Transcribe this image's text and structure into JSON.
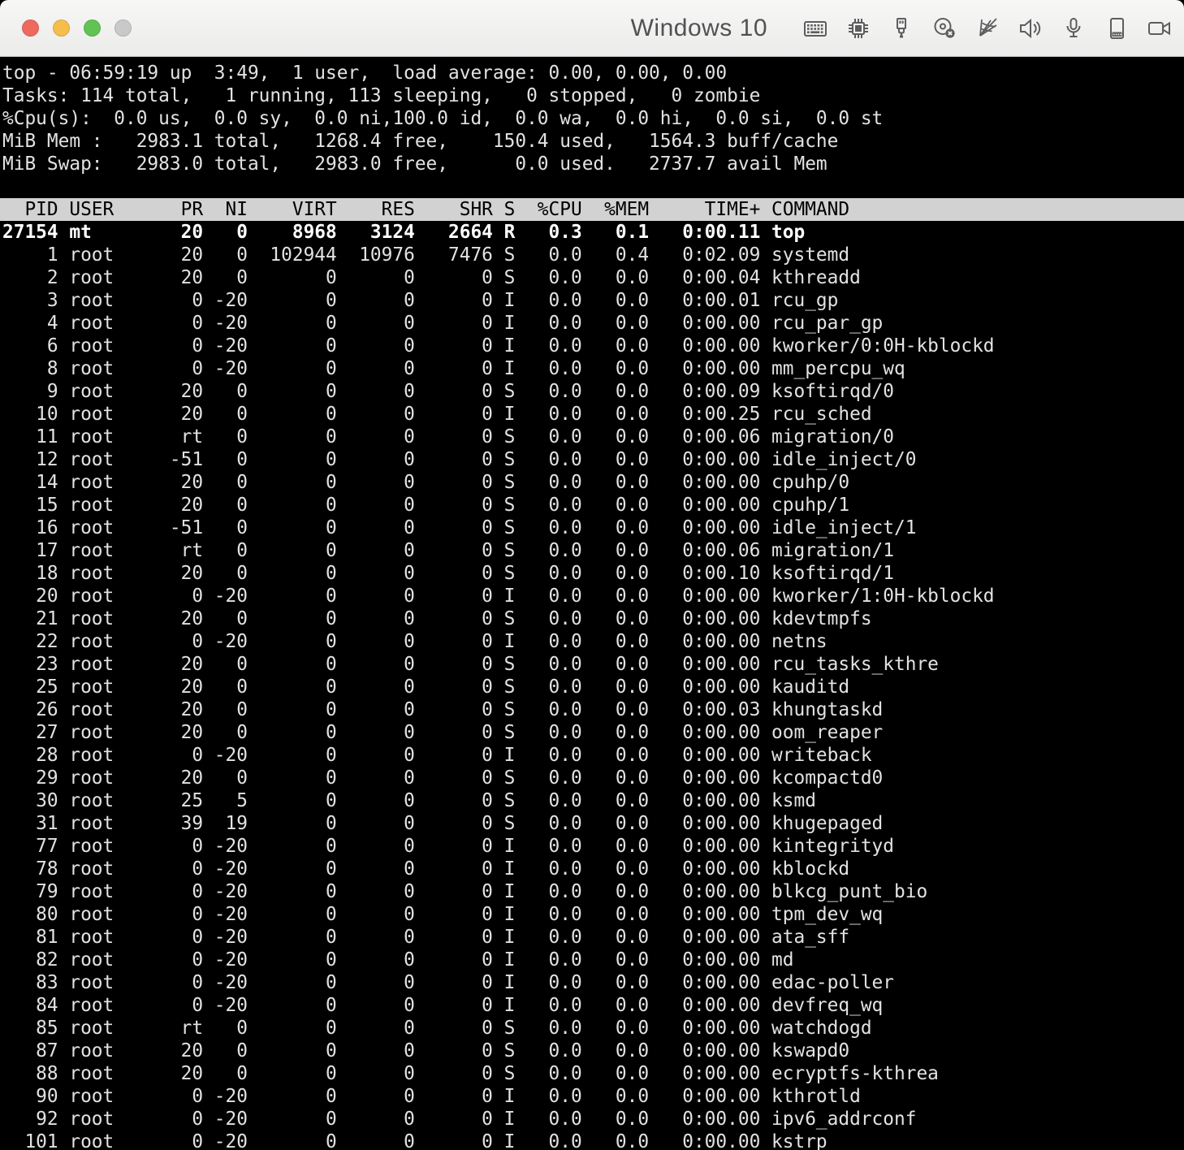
{
  "window": {
    "title": "Windows 10",
    "traffic_lights": [
      {
        "name": "close-button",
        "color": "#ee6a5f"
      },
      {
        "name": "minimize-button",
        "color": "#f5bd4c"
      },
      {
        "name": "zoom-button",
        "color": "#61c354"
      },
      {
        "name": "window-options-button",
        "color": "#c9c9c9"
      }
    ],
    "status_icons": [
      {
        "name": "keyboard-icon"
      },
      {
        "name": "cpu-icon"
      },
      {
        "name": "usb-icon"
      },
      {
        "name": "optical-disc-icon"
      },
      {
        "name": "network-icon"
      },
      {
        "name": "volume-icon"
      },
      {
        "name": "microphone-icon"
      },
      {
        "name": "external-drive-icon"
      },
      {
        "name": "video-camera-icon"
      }
    ]
  },
  "colors": {
    "terminal_bg": "#000000",
    "terminal_fg": "#e2e2e2",
    "table_header_bg": "#d2d2d2",
    "table_header_fg": "#000000",
    "running_row_fg": "#ffffff",
    "titlebar_text": "#515153",
    "icon_color": "#5d5d5f"
  },
  "terminal": {
    "summary_lines": [
      "top - 06:59:19 up  3:49,  1 user,  load average: 0.00, 0.00, 0.00",
      "Tasks: 114 total,   1 running, 113 sleeping,   0 stopped,   0 zombie",
      "%Cpu(s):  0.0 us,  0.0 sy,  0.0 ni,100.0 id,  0.0 wa,  0.0 hi,  0.0 si,  0.0 st",
      "MiB Mem :   2983.1 total,   1268.4 free,    150.4 used,   1564.3 buff/cache",
      "MiB Swap:   2983.0 total,   2983.0 free,      0.0 used.   2737.7 avail Mem"
    ],
    "table": {
      "columns": [
        {
          "label": "PID",
          "width": 5,
          "align": "right"
        },
        {
          "label": "USER",
          "width": 8,
          "align": "left"
        },
        {
          "label": "PR",
          "width": 3,
          "align": "right"
        },
        {
          "label": "NI",
          "width": 3,
          "align": "right"
        },
        {
          "label": "VIRT",
          "width": 7,
          "align": "right"
        },
        {
          "label": "RES",
          "width": 6,
          "align": "right"
        },
        {
          "label": "SHR",
          "width": 6,
          "align": "right"
        },
        {
          "label": "S",
          "width": 1,
          "align": "left"
        },
        {
          "label": "%CPU",
          "width": 5,
          "align": "right"
        },
        {
          "label": "%MEM",
          "width": 5,
          "align": "right"
        },
        {
          "label": "TIME+",
          "width": 9,
          "align": "right"
        },
        {
          "label": "COMMAND",
          "width": 7,
          "align": "left"
        }
      ],
      "running_row_index": 0,
      "processes": [
        [
          "27154",
          "mt",
          "20",
          "0",
          "8968",
          "3124",
          "2664",
          "R",
          "0.3",
          "0.1",
          "0:00.11",
          "top"
        ],
        [
          "1",
          "root",
          "20",
          "0",
          "102944",
          "10976",
          "7476",
          "S",
          "0.0",
          "0.4",
          "0:02.09",
          "systemd"
        ],
        [
          "2",
          "root",
          "20",
          "0",
          "0",
          "0",
          "0",
          "S",
          "0.0",
          "0.0",
          "0:00.04",
          "kthreadd"
        ],
        [
          "3",
          "root",
          "0",
          "-20",
          "0",
          "0",
          "0",
          "I",
          "0.0",
          "0.0",
          "0:00.01",
          "rcu_gp"
        ],
        [
          "4",
          "root",
          "0",
          "-20",
          "0",
          "0",
          "0",
          "I",
          "0.0",
          "0.0",
          "0:00.00",
          "rcu_par_gp"
        ],
        [
          "6",
          "root",
          "0",
          "-20",
          "0",
          "0",
          "0",
          "I",
          "0.0",
          "0.0",
          "0:00.00",
          "kworker/0:0H-kblockd"
        ],
        [
          "8",
          "root",
          "0",
          "-20",
          "0",
          "0",
          "0",
          "I",
          "0.0",
          "0.0",
          "0:00.00",
          "mm_percpu_wq"
        ],
        [
          "9",
          "root",
          "20",
          "0",
          "0",
          "0",
          "0",
          "S",
          "0.0",
          "0.0",
          "0:00.09",
          "ksoftirqd/0"
        ],
        [
          "10",
          "root",
          "20",
          "0",
          "0",
          "0",
          "0",
          "I",
          "0.0",
          "0.0",
          "0:00.25",
          "rcu_sched"
        ],
        [
          "11",
          "root",
          "rt",
          "0",
          "0",
          "0",
          "0",
          "S",
          "0.0",
          "0.0",
          "0:00.06",
          "migration/0"
        ],
        [
          "12",
          "root",
          "-51",
          "0",
          "0",
          "0",
          "0",
          "S",
          "0.0",
          "0.0",
          "0:00.00",
          "idle_inject/0"
        ],
        [
          "14",
          "root",
          "20",
          "0",
          "0",
          "0",
          "0",
          "S",
          "0.0",
          "0.0",
          "0:00.00",
          "cpuhp/0"
        ],
        [
          "15",
          "root",
          "20",
          "0",
          "0",
          "0",
          "0",
          "S",
          "0.0",
          "0.0",
          "0:00.00",
          "cpuhp/1"
        ],
        [
          "16",
          "root",
          "-51",
          "0",
          "0",
          "0",
          "0",
          "S",
          "0.0",
          "0.0",
          "0:00.00",
          "idle_inject/1"
        ],
        [
          "17",
          "root",
          "rt",
          "0",
          "0",
          "0",
          "0",
          "S",
          "0.0",
          "0.0",
          "0:00.06",
          "migration/1"
        ],
        [
          "18",
          "root",
          "20",
          "0",
          "0",
          "0",
          "0",
          "S",
          "0.0",
          "0.0",
          "0:00.10",
          "ksoftirqd/1"
        ],
        [
          "20",
          "root",
          "0",
          "-20",
          "0",
          "0",
          "0",
          "I",
          "0.0",
          "0.0",
          "0:00.00",
          "kworker/1:0H-kblockd"
        ],
        [
          "21",
          "root",
          "20",
          "0",
          "0",
          "0",
          "0",
          "S",
          "0.0",
          "0.0",
          "0:00.00",
          "kdevtmpfs"
        ],
        [
          "22",
          "root",
          "0",
          "-20",
          "0",
          "0",
          "0",
          "I",
          "0.0",
          "0.0",
          "0:00.00",
          "netns"
        ],
        [
          "23",
          "root",
          "20",
          "0",
          "0",
          "0",
          "0",
          "S",
          "0.0",
          "0.0",
          "0:00.00",
          "rcu_tasks_kthre"
        ],
        [
          "25",
          "root",
          "20",
          "0",
          "0",
          "0",
          "0",
          "S",
          "0.0",
          "0.0",
          "0:00.00",
          "kauditd"
        ],
        [
          "26",
          "root",
          "20",
          "0",
          "0",
          "0",
          "0",
          "S",
          "0.0",
          "0.0",
          "0:00.03",
          "khungtaskd"
        ],
        [
          "27",
          "root",
          "20",
          "0",
          "0",
          "0",
          "0",
          "S",
          "0.0",
          "0.0",
          "0:00.00",
          "oom_reaper"
        ],
        [
          "28",
          "root",
          "0",
          "-20",
          "0",
          "0",
          "0",
          "I",
          "0.0",
          "0.0",
          "0:00.00",
          "writeback"
        ],
        [
          "29",
          "root",
          "20",
          "0",
          "0",
          "0",
          "0",
          "S",
          "0.0",
          "0.0",
          "0:00.00",
          "kcompactd0"
        ],
        [
          "30",
          "root",
          "25",
          "5",
          "0",
          "0",
          "0",
          "S",
          "0.0",
          "0.0",
          "0:00.00",
          "ksmd"
        ],
        [
          "31",
          "root",
          "39",
          "19",
          "0",
          "0",
          "0",
          "S",
          "0.0",
          "0.0",
          "0:00.00",
          "khugepaged"
        ],
        [
          "77",
          "root",
          "0",
          "-20",
          "0",
          "0",
          "0",
          "I",
          "0.0",
          "0.0",
          "0:00.00",
          "kintegrityd"
        ],
        [
          "78",
          "root",
          "0",
          "-20",
          "0",
          "0",
          "0",
          "I",
          "0.0",
          "0.0",
          "0:00.00",
          "kblockd"
        ],
        [
          "79",
          "root",
          "0",
          "-20",
          "0",
          "0",
          "0",
          "I",
          "0.0",
          "0.0",
          "0:00.00",
          "blkcg_punt_bio"
        ],
        [
          "80",
          "root",
          "0",
          "-20",
          "0",
          "0",
          "0",
          "I",
          "0.0",
          "0.0",
          "0:00.00",
          "tpm_dev_wq"
        ],
        [
          "81",
          "root",
          "0",
          "-20",
          "0",
          "0",
          "0",
          "I",
          "0.0",
          "0.0",
          "0:00.00",
          "ata_sff"
        ],
        [
          "82",
          "root",
          "0",
          "-20",
          "0",
          "0",
          "0",
          "I",
          "0.0",
          "0.0",
          "0:00.00",
          "md"
        ],
        [
          "83",
          "root",
          "0",
          "-20",
          "0",
          "0",
          "0",
          "I",
          "0.0",
          "0.0",
          "0:00.00",
          "edac-poller"
        ],
        [
          "84",
          "root",
          "0",
          "-20",
          "0",
          "0",
          "0",
          "I",
          "0.0",
          "0.0",
          "0:00.00",
          "devfreq_wq"
        ],
        [
          "85",
          "root",
          "rt",
          "0",
          "0",
          "0",
          "0",
          "S",
          "0.0",
          "0.0",
          "0:00.00",
          "watchdogd"
        ],
        [
          "87",
          "root",
          "20",
          "0",
          "0",
          "0",
          "0",
          "S",
          "0.0",
          "0.0",
          "0:00.00",
          "kswapd0"
        ],
        [
          "88",
          "root",
          "20",
          "0",
          "0",
          "0",
          "0",
          "S",
          "0.0",
          "0.0",
          "0:00.00",
          "ecryptfs-kthrea"
        ],
        [
          "90",
          "root",
          "0",
          "-20",
          "0",
          "0",
          "0",
          "I",
          "0.0",
          "0.0",
          "0:00.00",
          "kthrotld"
        ],
        [
          "92",
          "root",
          "0",
          "-20",
          "0",
          "0",
          "0",
          "I",
          "0.0",
          "0.0",
          "0:00.00",
          "ipv6_addrconf"
        ],
        [
          "101",
          "root",
          "0",
          "-20",
          "0",
          "0",
          "0",
          "I",
          "0.0",
          "0.0",
          "0:00.00",
          "kstrp"
        ]
      ]
    }
  }
}
